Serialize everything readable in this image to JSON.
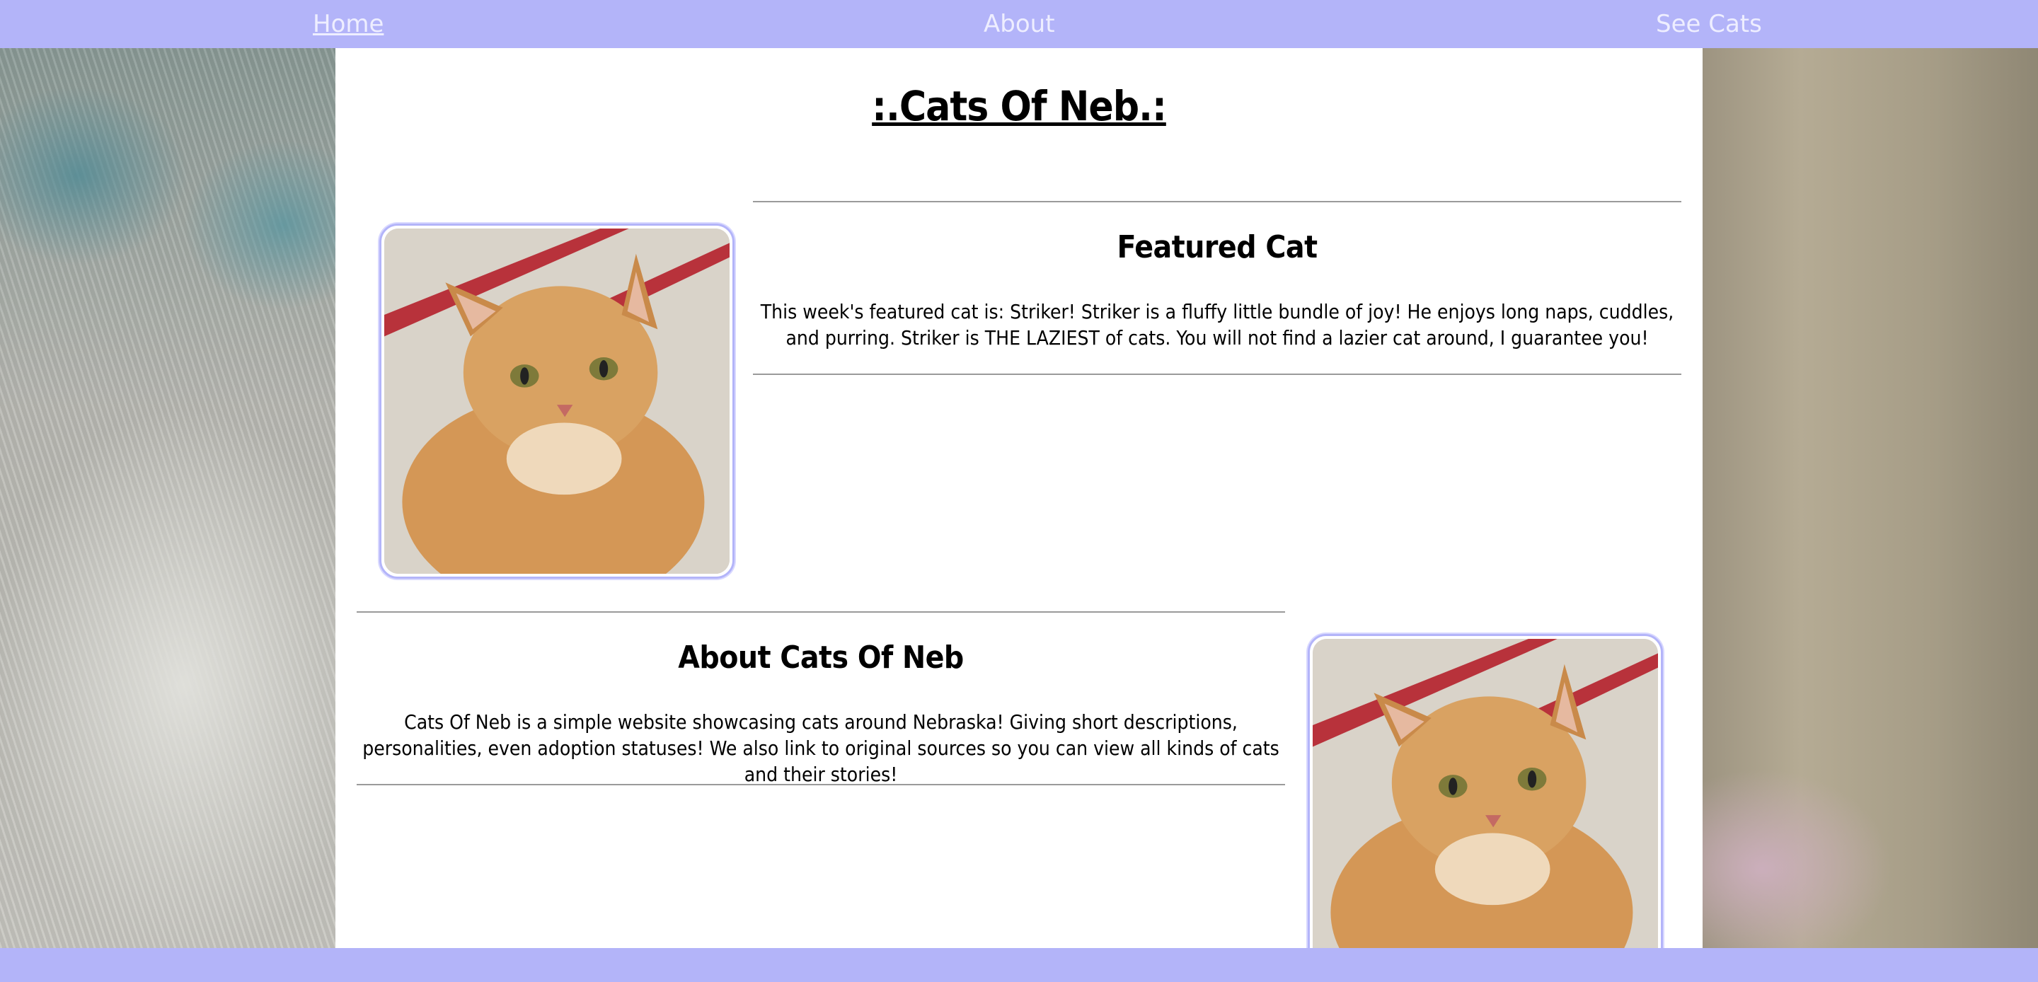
{
  "nav": {
    "home": "Home",
    "about": "About",
    "see_cats": "See Cats"
  },
  "title": ":.Cats Of Neb.:",
  "featured": {
    "heading": "Featured Cat",
    "text": "This week's featured cat is: Striker! Striker is a fluffy little bundle of joy! He enjoys long naps, cuddles, and purring. Striker is THE LAZIEST of cats. You will not find a lazier cat around, I guarantee you!"
  },
  "about": {
    "heading": "About Cats Of Neb",
    "text": "Cats Of Neb is a simple website showcasing cats around Nebraska! Giving short descriptions, personalities, even adoption statuses! We also link to original sources so you can view all kinds of cats and their stories!"
  },
  "colors": {
    "nav_bar": "#b3b4f9",
    "nav_text": "#eeeeff",
    "panel": "#ffffff",
    "rule": "#9a9a9a"
  }
}
